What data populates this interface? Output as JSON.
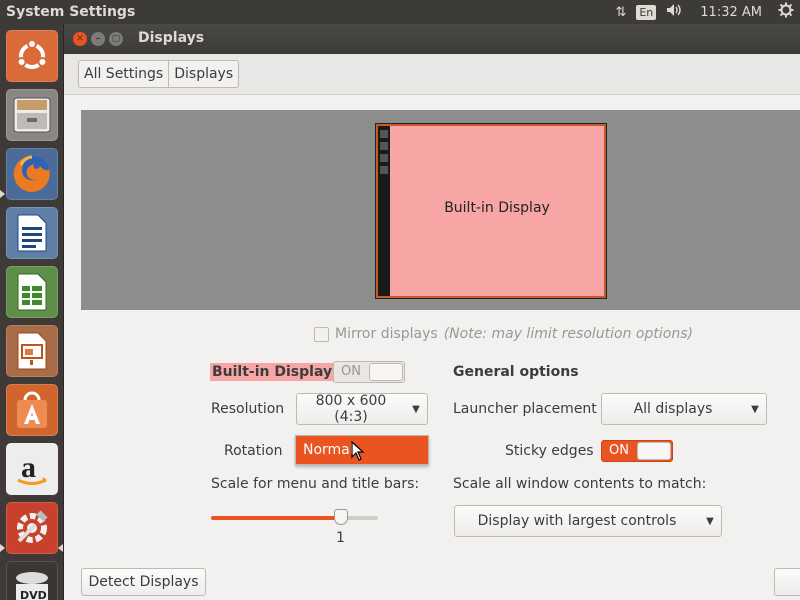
{
  "top_panel": {
    "app_title": "System Settings",
    "lang": "En",
    "time": "11:32 AM"
  },
  "window": {
    "title": "Displays",
    "close_glyph": "✕",
    "min_glyph": "–",
    "max_glyph": "▢"
  },
  "breadcrumb": {
    "items": [
      "All Settings",
      "Displays"
    ]
  },
  "arrangement": {
    "monitor_label": "Built-in Display"
  },
  "mirror": {
    "label": "Mirror displays",
    "note": "(Note: may limit resolution options)",
    "checked": false
  },
  "display_options": {
    "name": "Built-in Display",
    "toggle_text": "ON",
    "toggle_on": false,
    "resolution_label": "Resolution",
    "resolution_value": "800 x 600 (4:3)",
    "rotation_label": "Rotation",
    "rotation_value": "Normal",
    "scale_label": "Scale for menu and title bars:",
    "scale_value": "1",
    "scale_fraction": 0.78
  },
  "general_options": {
    "title": "General options",
    "launcher_label": "Launcher placement",
    "launcher_value": "All displays",
    "sticky_label": "Sticky edges",
    "sticky_text": "ON",
    "sticky_on": true,
    "scale_all_label": "Scale all window contents to match:",
    "scale_all_value": "Display with largest controls"
  },
  "buttons": {
    "detect": "Detect Displays"
  },
  "colors": {
    "accent": "#e95420",
    "display_highlight": "#f8a5a5",
    "panel": "#3c3b37",
    "launcher": "#3f3a38"
  },
  "launcher_icons": [
    "ubuntu-logo-icon",
    "files-icon",
    "firefox-icon",
    "writer-icon",
    "calc-icon",
    "impress-icon",
    "software-center-icon",
    "amazon-icon",
    "system-settings-icon",
    "dvd-icon"
  ]
}
